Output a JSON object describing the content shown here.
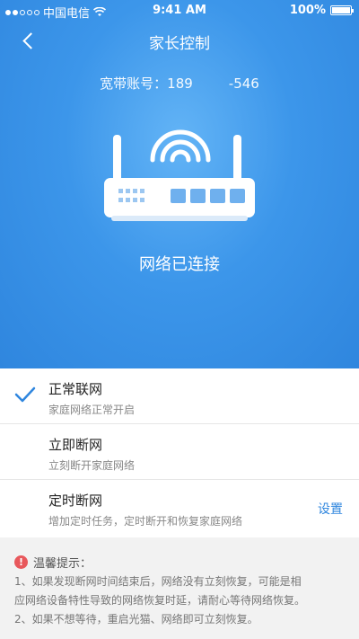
{
  "status_bar": {
    "carrier": "中国电信",
    "time": "9:41 AM",
    "battery": "100%"
  },
  "nav": {
    "title": "家长控制"
  },
  "account": {
    "label": "宽带账号：",
    "value_start": "189",
    "value_end": "-546"
  },
  "router": {
    "status": "网络已连接"
  },
  "options": [
    {
      "title": "正常联网",
      "subtitle": "家庭网络正常开启",
      "selected": true
    },
    {
      "title": "立即断网",
      "subtitle": "立刻断开家庭网络",
      "selected": false
    },
    {
      "title": "定时断网",
      "subtitle": "增加定时任务，定时断开和恢复家庭网络",
      "action": "设置",
      "selected": false
    }
  ],
  "tips": {
    "title": "温馨提示：",
    "icon": "!",
    "lines": [
      "1、如果发现断网时间结束后，网络没有立刻恢复，可能是相",
      "应网络设备特性导致的网络恢复时延，请耐心等待网络恢复。",
      "2、如果不想等待，重启光猫、网络即可立刻恢复。"
    ]
  },
  "colors": {
    "hero": "#3c96ea",
    "accent": "#2f86de",
    "tip_icon": "#e8585c"
  }
}
